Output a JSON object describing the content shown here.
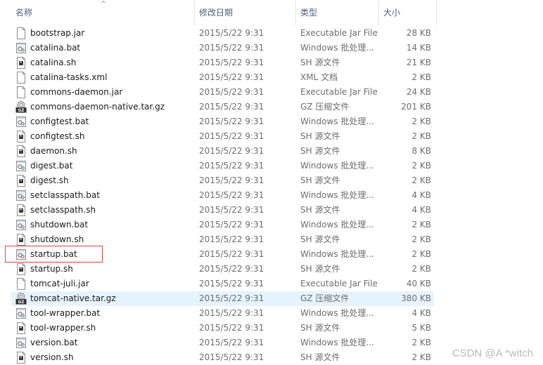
{
  "columns": {
    "name": "名称",
    "date": "修改日期",
    "type": "类型",
    "size": "大小",
    "sort_indicator": "^"
  },
  "files": [
    {
      "name": "bootstrap.jar",
      "date": "2015/5/22 9:31",
      "type": "Executable Jar File",
      "size": "28 KB",
      "icon": "jar-file-icon"
    },
    {
      "name": "catalina.bat",
      "date": "2015/5/22 9:31",
      "type": "Windows 批处理...",
      "size": "14 KB",
      "icon": "batch-file-icon"
    },
    {
      "name": "catalina.sh",
      "date": "2015/5/22 9:31",
      "type": "SH 源文件",
      "size": "21 KB",
      "icon": "sh-file-icon"
    },
    {
      "name": "catalina-tasks.xml",
      "date": "2015/5/22 9:31",
      "type": "XML 文档",
      "size": "2 KB",
      "icon": "xml-file-icon"
    },
    {
      "name": "commons-daemon.jar",
      "date": "2015/5/22 9:31",
      "type": "Executable Jar File",
      "size": "24 KB",
      "icon": "jar-file-icon"
    },
    {
      "name": "commons-daemon-native.tar.gz",
      "date": "2015/5/22 9:31",
      "type": "GZ 压缩文件",
      "size": "201 KB",
      "icon": "gz-archive-icon"
    },
    {
      "name": "configtest.bat",
      "date": "2015/5/22 9:31",
      "type": "Windows 批处理...",
      "size": "2 KB",
      "icon": "batch-file-icon"
    },
    {
      "name": "configtest.sh",
      "date": "2015/5/22 9:31",
      "type": "SH 源文件",
      "size": "2 KB",
      "icon": "sh-file-icon"
    },
    {
      "name": "daemon.sh",
      "date": "2015/5/22 9:31",
      "type": "SH 源文件",
      "size": "8 KB",
      "icon": "sh-file-icon"
    },
    {
      "name": "digest.bat",
      "date": "2015/5/22 9:31",
      "type": "Windows 批处理...",
      "size": "2 KB",
      "icon": "batch-file-icon"
    },
    {
      "name": "digest.sh",
      "date": "2015/5/22 9:31",
      "type": "SH 源文件",
      "size": "2 KB",
      "icon": "sh-file-icon"
    },
    {
      "name": "setclasspath.bat",
      "date": "2015/5/22 9:31",
      "type": "Windows 批处理...",
      "size": "4 KB",
      "icon": "batch-file-icon"
    },
    {
      "name": "setclasspath.sh",
      "date": "2015/5/22 9:31",
      "type": "SH 源文件",
      "size": "4 KB",
      "icon": "sh-file-icon"
    },
    {
      "name": "shutdown.bat",
      "date": "2015/5/22 9:31",
      "type": "Windows 批处理...",
      "size": "2 KB",
      "icon": "batch-file-icon"
    },
    {
      "name": "shutdown.sh",
      "date": "2015/5/22 9:31",
      "type": "SH 源文件",
      "size": "2 KB",
      "icon": "sh-file-icon"
    },
    {
      "name": "startup.bat",
      "date": "2015/5/22 9:31",
      "type": "Windows 批处理...",
      "size": "2 KB",
      "icon": "batch-file-icon"
    },
    {
      "name": "startup.sh",
      "date": "2015/5/22 9:31",
      "type": "SH 源文件",
      "size": "2 KB",
      "icon": "sh-file-icon"
    },
    {
      "name": "tomcat-juli.jar",
      "date": "2015/5/22 9:31",
      "type": "Executable Jar File",
      "size": "40 KB",
      "icon": "jar-file-icon"
    },
    {
      "name": "tomcat-native.tar.gz",
      "date": "2015/5/22 9:31",
      "type": "GZ 压缩文件",
      "size": "380 KB",
      "icon": "gz-archive-icon"
    },
    {
      "name": "tool-wrapper.bat",
      "date": "2015/5/22 9:31",
      "type": "Windows 批处理...",
      "size": "4 KB",
      "icon": "batch-file-icon"
    },
    {
      "name": "tool-wrapper.sh",
      "date": "2015/5/22 9:31",
      "type": "SH 源文件",
      "size": "5 KB",
      "icon": "sh-file-icon"
    },
    {
      "name": "version.bat",
      "date": "2015/5/22 9:31",
      "type": "Windows 批处理...",
      "size": "2 KB",
      "icon": "batch-file-icon"
    },
    {
      "name": "version.sh",
      "date": "2015/5/22 9:31",
      "type": "SH 源文件",
      "size": "2 KB",
      "icon": "sh-file-icon"
    }
  ],
  "selected_file": "tomcat-native.tar.gz",
  "highlighted_file": "startup.bat",
  "colors": {
    "selection": "#e5f3ff",
    "highlight_border": "#d9443b",
    "header_text": "#4c607a"
  },
  "watermark": "CSDN @A *witch"
}
